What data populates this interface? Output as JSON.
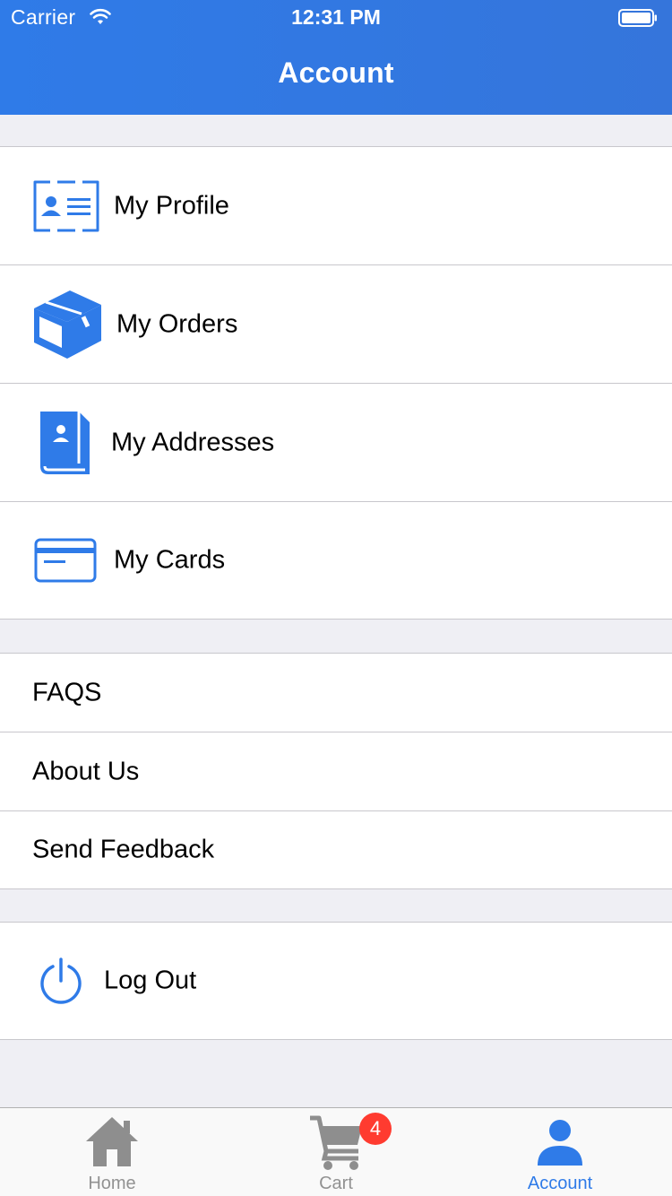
{
  "status_bar": {
    "carrier": "Carrier",
    "time": "12:31 PM"
  },
  "nav": {
    "title": "Account"
  },
  "account_items": [
    {
      "label": "My Profile",
      "icon": "profile-card-icon"
    },
    {
      "label": "My Orders",
      "icon": "box-icon"
    },
    {
      "label": "My Addresses",
      "icon": "address-book-icon"
    },
    {
      "label": "My Cards",
      "icon": "credit-card-icon"
    }
  ],
  "info_items": [
    {
      "label": "FAQS"
    },
    {
      "label": "About Us"
    },
    {
      "label": "Send Feedback"
    }
  ],
  "logout": {
    "label": "Log Out",
    "icon": "power-icon"
  },
  "tabbar": {
    "tabs": [
      {
        "label": "Home",
        "icon": "home-icon",
        "active": false
      },
      {
        "label": "Cart",
        "icon": "cart-icon",
        "active": false,
        "badge": "4"
      },
      {
        "label": "Account",
        "icon": "person-icon",
        "active": true
      }
    ]
  },
  "colors": {
    "accent": "#2f7be8",
    "badge": "#ff3b30",
    "background": "#efeff4",
    "tab_inactive": "#929292"
  }
}
